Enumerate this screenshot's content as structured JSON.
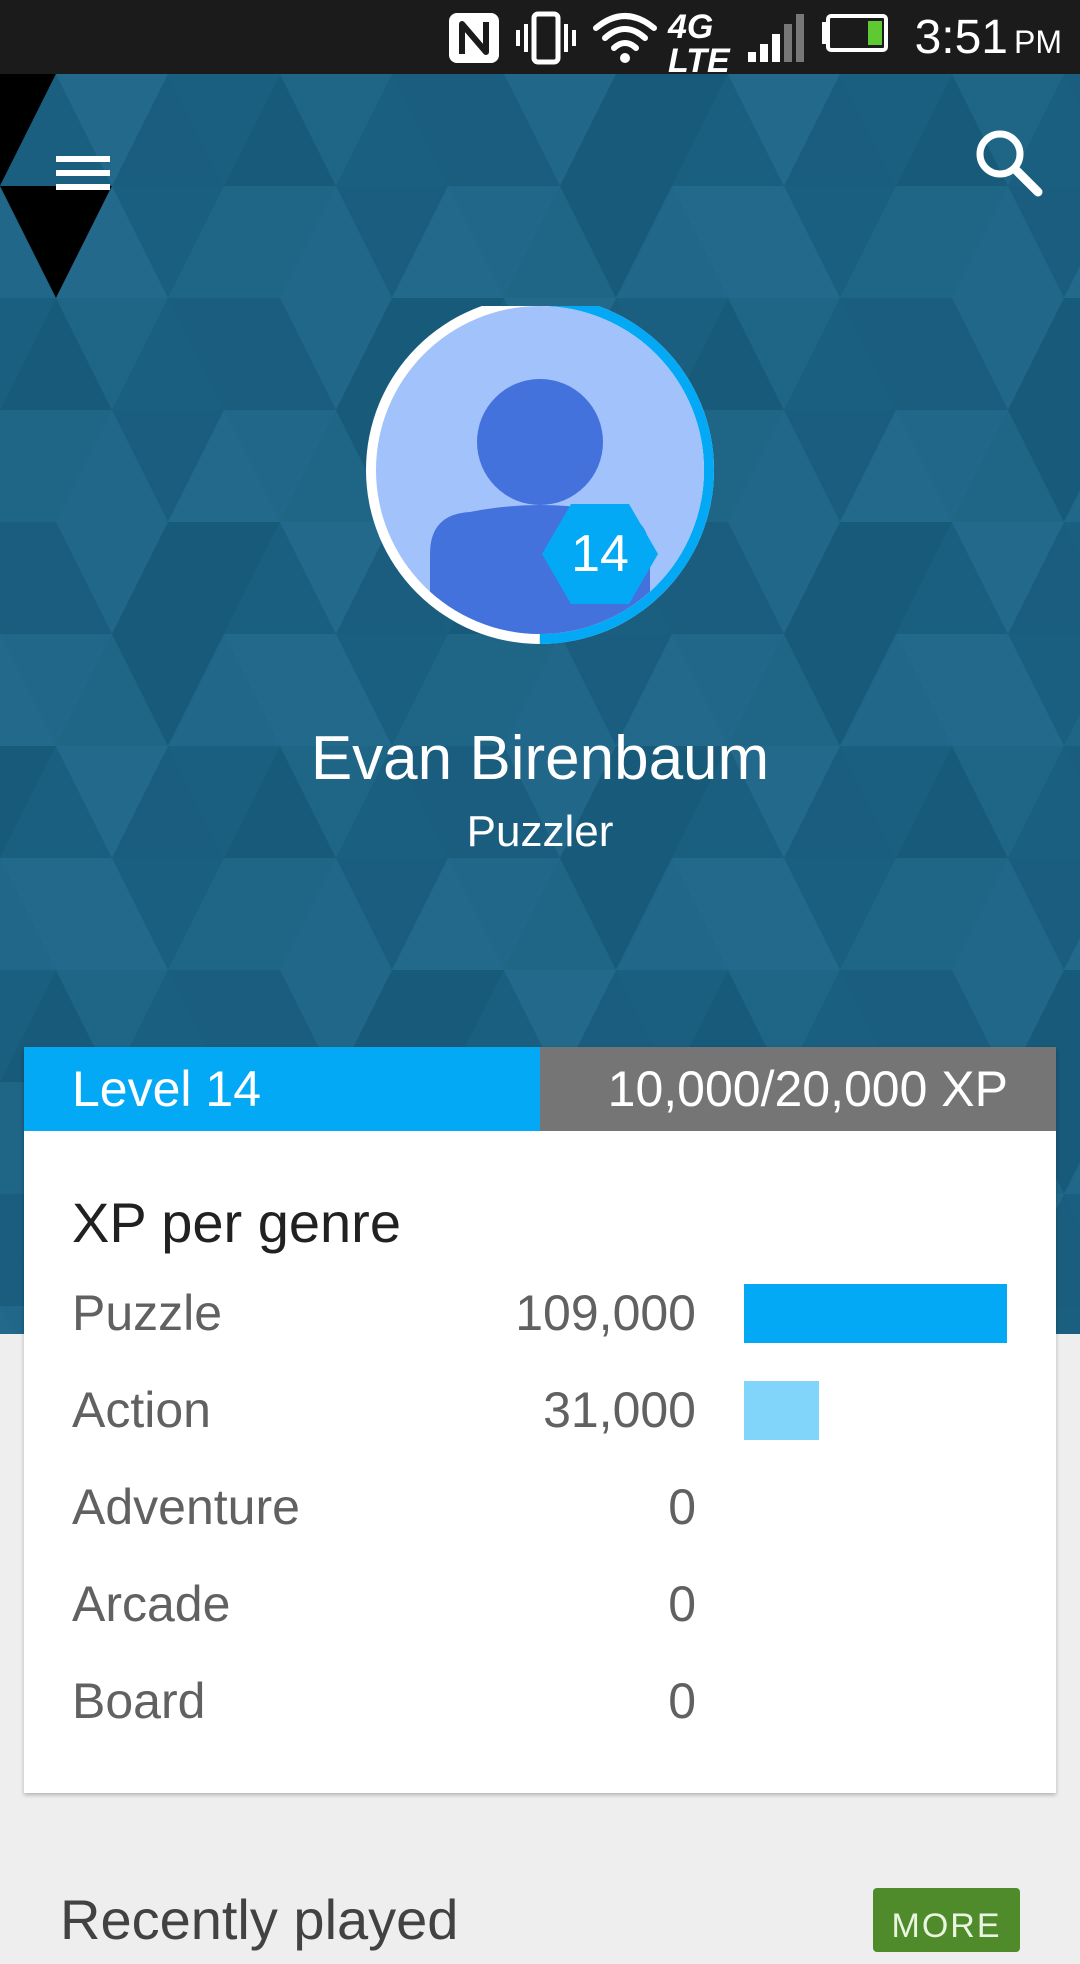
{
  "status_bar": {
    "time": "3:51",
    "ampm": "PM",
    "network": "4G LTE",
    "icons": [
      "nfc-icon",
      "vibrate-icon",
      "wifi-icon",
      "lte-icon",
      "signal-icon",
      "battery-icon"
    ]
  },
  "toolbar": {
    "menu_icon": "menu-icon",
    "search_icon": "search-icon"
  },
  "profile": {
    "name": "Evan Birenbaum",
    "title": "Puzzler",
    "level_badge": "14",
    "level_progress": 0.5
  },
  "level": {
    "label": "Level 14",
    "xp": "10,000/20,000 XP",
    "progress": 0.5
  },
  "genres": {
    "title": "XP per genre",
    "max_value": 109000,
    "items": [
      {
        "name": "Puzzle",
        "value": "109,000",
        "amount": 109000,
        "color": "#03a9f4"
      },
      {
        "name": "Action",
        "value": "31,000",
        "amount": 31000,
        "color": "#81d4fa"
      },
      {
        "name": "Adventure",
        "value": "0",
        "amount": 0,
        "color": "#81d4fa"
      },
      {
        "name": "Arcade",
        "value": "0",
        "amount": 0,
        "color": "#81d4fa"
      },
      {
        "name": "Board",
        "value": "0",
        "amount": 0,
        "color": "#81d4fa"
      }
    ]
  },
  "recent": {
    "title": "Recently played",
    "more_label": "MORE"
  },
  "colors": {
    "accent": "#03a9f4",
    "hero_background": "#1f6687",
    "more_button": "#4f8a2b"
  }
}
